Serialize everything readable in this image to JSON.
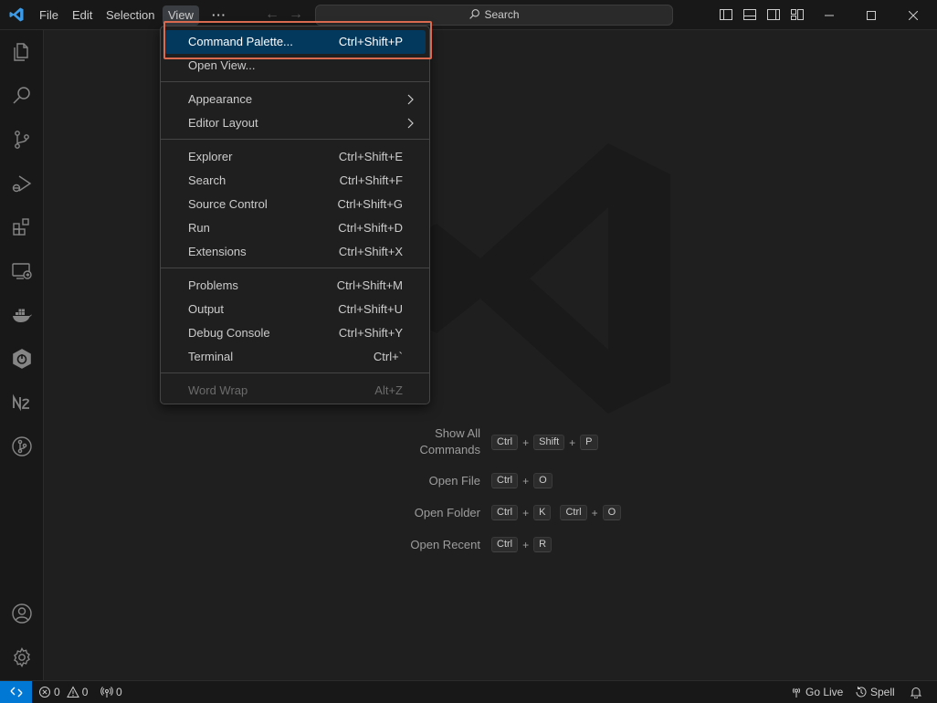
{
  "titlebar": {
    "menus": [
      "File",
      "Edit",
      "Selection",
      "View"
    ],
    "more": "···",
    "search_label": "Search"
  },
  "view_menu": {
    "items": [
      {
        "label": "Command Palette...",
        "shortcut": "Ctrl+Shift+P",
        "highlighted": true
      },
      {
        "label": "Open View...",
        "shortcut": ""
      },
      {
        "label": "Appearance",
        "submenu": true
      },
      {
        "label": "Editor Layout",
        "submenu": true
      },
      {
        "label": "Explorer",
        "shortcut": "Ctrl+Shift+E"
      },
      {
        "label": "Search",
        "shortcut": "Ctrl+Shift+F"
      },
      {
        "label": "Source Control",
        "shortcut": "Ctrl+Shift+G"
      },
      {
        "label": "Run",
        "shortcut": "Ctrl+Shift+D"
      },
      {
        "label": "Extensions",
        "shortcut": "Ctrl+Shift+X"
      },
      {
        "label": "Problems",
        "shortcut": "Ctrl+Shift+M"
      },
      {
        "label": "Output",
        "shortcut": "Ctrl+Shift+U"
      },
      {
        "label": "Debug Console",
        "shortcut": "Ctrl+Shift+Y"
      },
      {
        "label": "Terminal",
        "shortcut": "Ctrl+`"
      },
      {
        "label": "Word Wrap",
        "shortcut": "Alt+Z",
        "disabled": true
      }
    ]
  },
  "activity_bar": {
    "icons": [
      "explorer-icon",
      "search-icon",
      "source-control-icon",
      "run-debug-icon",
      "extensions-icon",
      "remote-explorer-icon",
      "docker-icon",
      "spring-boot-icon",
      "nx-console-icon",
      "git-graph-icon",
      "account-icon",
      "settings-gear-icon"
    ]
  },
  "shortcuts": {
    "show_all_line1": "Show All",
    "show_all_line2": "Commands",
    "show_all_keys": [
      "Ctrl",
      "Shift",
      "P"
    ],
    "open_file": "Open File",
    "open_file_keys": [
      "Ctrl",
      "O"
    ],
    "open_folder": "Open Folder",
    "open_folder_keys_a": [
      "Ctrl",
      "K"
    ],
    "open_folder_keys_b": [
      "Ctrl",
      "O"
    ],
    "open_recent": "Open Recent",
    "open_recent_keys": [
      "Ctrl",
      "R"
    ],
    "plus": "+"
  },
  "statusbar": {
    "errors": "0",
    "warnings": "0",
    "ports": "0",
    "go_live": "Go Live",
    "spell": "Spell"
  },
  "colors": {
    "accent": "#0078d4",
    "menu_highlight": "#04395e",
    "focus_outline": "#d9694f"
  }
}
